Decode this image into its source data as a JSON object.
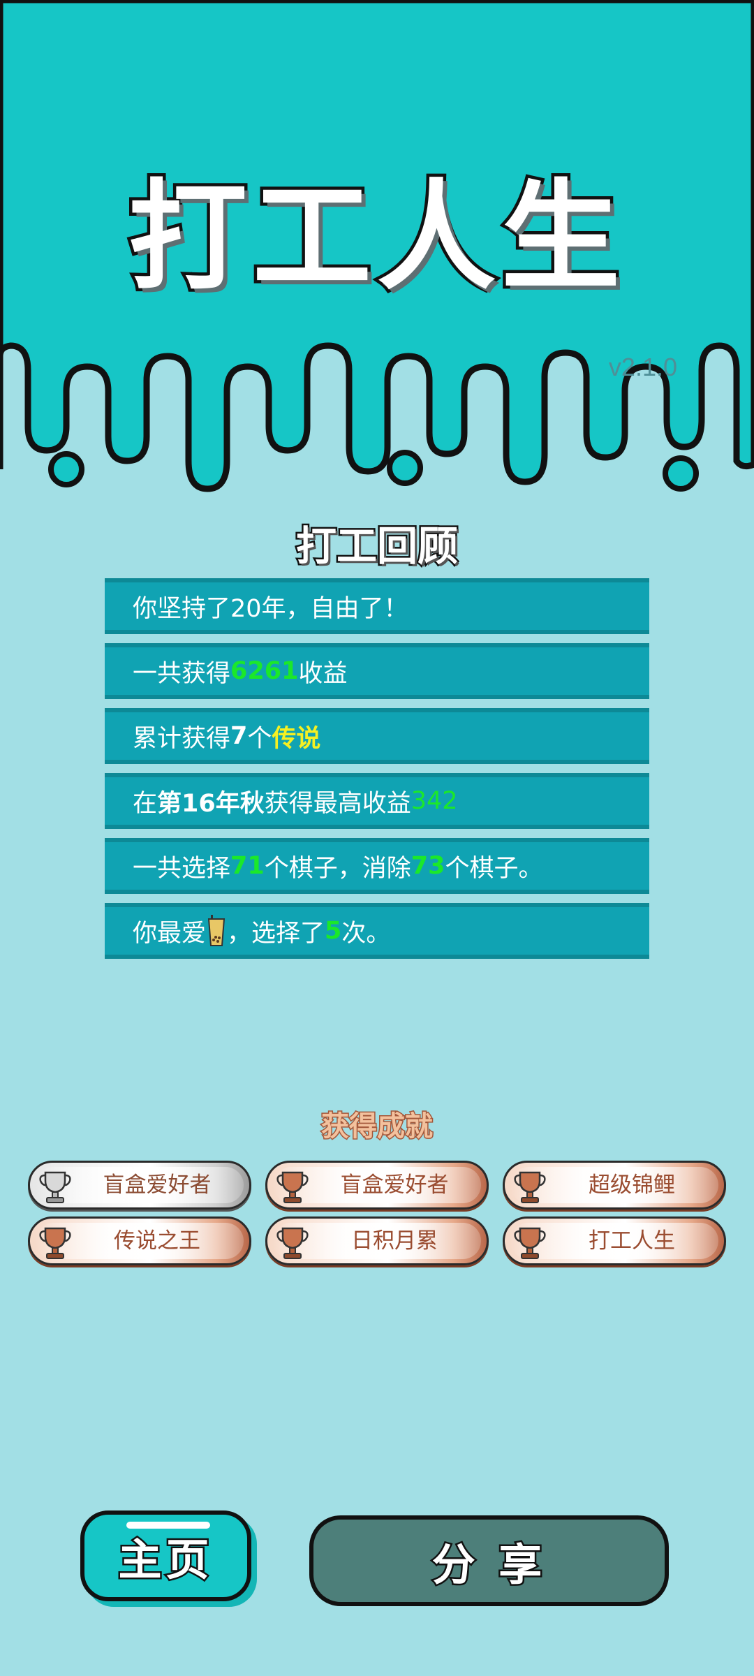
{
  "app": {
    "title": "打工人生",
    "version": "v2.1.0"
  },
  "colors": {
    "top": "#16c6c6",
    "bg": "#a2dfe5",
    "row": "#10a3b3",
    "green": "#1be82a",
    "yellow": "#f5f022"
  },
  "review": {
    "title": "打工回顾",
    "row1": {
      "text": "你坚持了20年，自由了！"
    },
    "row2": {
      "pre": "一共获得",
      "num": "6261",
      "post": "收益"
    },
    "row3": {
      "pre": "累计获得",
      "num": "7",
      "mid": "个",
      "hl": "传说"
    },
    "row4": {
      "pre": "在 ",
      "season": "第16年秋",
      "mid": " 获得最高收益",
      "num": "342"
    },
    "row5": {
      "pre": "一共选择",
      "n1": "71",
      "mid": "个棋子，消除",
      "n2": "73",
      "post": "个棋子。"
    },
    "row6": {
      "pre": "你最爱",
      "icon": "bubble-tea-icon",
      "mid": "，选择了",
      "num": "5",
      "post": "次。"
    }
  },
  "achievements": {
    "title": "获得成就",
    "items": [
      {
        "label": "盲盒爱好者",
        "tier": "silver"
      },
      {
        "label": "盲盒爱好者",
        "tier": "bronze"
      },
      {
        "label": "超级锦鲤",
        "tier": "bronze"
      },
      {
        "label": "传说之王",
        "tier": "bronze"
      },
      {
        "label": "日积月累",
        "tier": "bronze"
      },
      {
        "label": "打工人生",
        "tier": "bronze"
      }
    ]
  },
  "buttons": {
    "home": "主页",
    "share": "分 享"
  }
}
